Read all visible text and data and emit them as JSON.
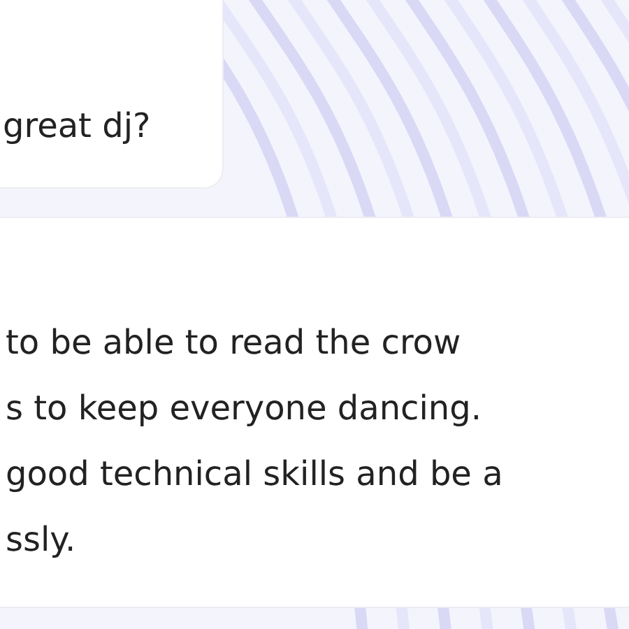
{
  "messages": [
    {
      "kind": "question",
      "lines": [
        "great dj?"
      ]
    },
    {
      "kind": "answer",
      "lines": [
        "to be able to read the crow",
        "s to keep everyone dancing.",
        "good technical skills and be a",
        "ssly."
      ]
    }
  ]
}
